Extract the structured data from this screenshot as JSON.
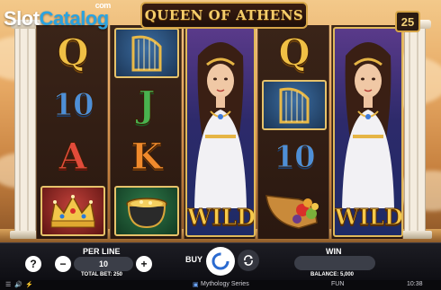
{
  "brand": {
    "part1": "Slot",
    "part2": "Catalog",
    "suffix": "com"
  },
  "game": {
    "title": "QUEEN OF ATHENS",
    "lines": "25"
  },
  "reels": {
    "r1": [
      "Q",
      "10",
      "A",
      "crown"
    ],
    "r2": [
      "harp",
      "J",
      "K",
      "cauldron"
    ],
    "r3": [
      "athena-wild"
    ],
    "r4": [
      "Q",
      "harp",
      "10",
      "cornucopia"
    ],
    "r5": [
      "athena-wild"
    ]
  },
  "symbols": {
    "q": "Q",
    "ten": "10",
    "a": "A",
    "j": "J",
    "k": "K",
    "wild": "WILD"
  },
  "controls": {
    "help_label": "?",
    "per_line_label": "PER LINE",
    "per_line_value": "10",
    "minus_label": "−",
    "plus_label": "+",
    "total_bet_label": "TOTAL BET: 250",
    "buy_label": "BUY",
    "win_label": "WIN",
    "win_value": "",
    "balance_label": "BALANCE: 5,000"
  },
  "statusbar": {
    "series_label": "Mythology Series",
    "mode_label": "FUN",
    "time_label": "10:38"
  },
  "colors": {
    "gold": "#f0c045",
    "panel": "#15151b",
    "accent_blue": "#2aa3e0"
  }
}
